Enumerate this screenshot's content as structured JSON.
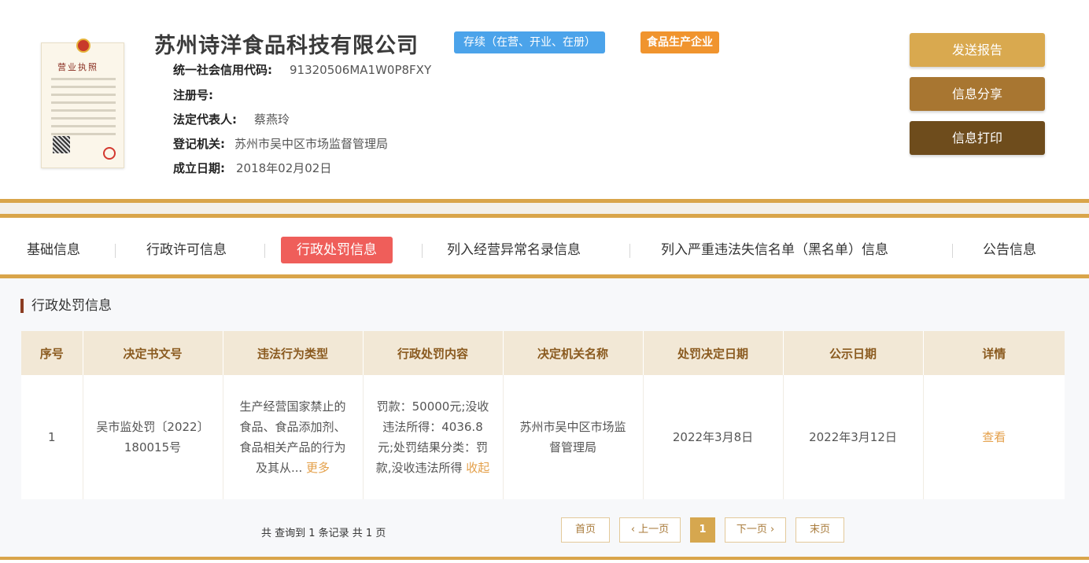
{
  "company": {
    "name": "苏州诗洋食品科技有限公司",
    "status_badge": "存续（在营、开业、在册）",
    "type_badge": "食品生产企业",
    "license_title": "营业执照",
    "fields": [
      {
        "label": "统一社会信用代码:",
        "value": "91320506MA1W0P8FXY"
      },
      {
        "label": "注册号:",
        "value": ""
      },
      {
        "label": "法定代表人:",
        "value": "蔡燕玲"
      },
      {
        "label": "登记机关:",
        "value": "苏州市吴中区市场监督管理局"
      },
      {
        "label": "成立日期:",
        "value": "2018年02月02日"
      }
    ]
  },
  "actions": {
    "send_report": "发送报告",
    "share_info": "信息分享",
    "print_info": "信息打印"
  },
  "tabs": [
    {
      "label": "基础信息",
      "active": false
    },
    {
      "label": "行政许可信息",
      "active": false
    },
    {
      "label": "行政处罚信息",
      "active": true
    },
    {
      "label": "列入经营异常名录信息",
      "active": false
    },
    {
      "label": "列入严重违法失信名单（黑名单）信息",
      "active": false
    },
    {
      "label": "公告信息",
      "active": false
    }
  ],
  "section": {
    "title": "行政处罚信息"
  },
  "table": {
    "headers": [
      "序号",
      "决定书文号",
      "违法行为类型",
      "行政处罚内容",
      "决定机关名称",
      "处罚决定日期",
      "公示日期",
      "详情"
    ],
    "rows": [
      {
        "index": "1",
        "doc_no": "吴市监处罚〔2022〕180015号",
        "violation": "生产经营国家禁止的食品、食品添加剂、食品相关产品的行为及其从...",
        "violation_more": "更多",
        "content": "罚款：50000元;没收违法所得：4036.8元;处罚结果分类：罚款,没收违法所得",
        "content_collapse": "收起",
        "authority": "苏州市吴中区市场监督管理局",
        "decision_date": "2022年3月8日",
        "publish_date": "2022年3月12日",
        "detail": "查看"
      }
    ]
  },
  "pagination": {
    "summary": "共 查询到 1 条记录 共 1 页",
    "first": "首页",
    "prev": "‹ 上一页",
    "current": "1",
    "next": "下一页 ›",
    "last": "末页"
  },
  "colors": {
    "accent_gold": "#d9a54a",
    "active_tab": "#ef5e5a",
    "status_blue": "#4ba3ea",
    "type_orange": "#f0942e"
  }
}
